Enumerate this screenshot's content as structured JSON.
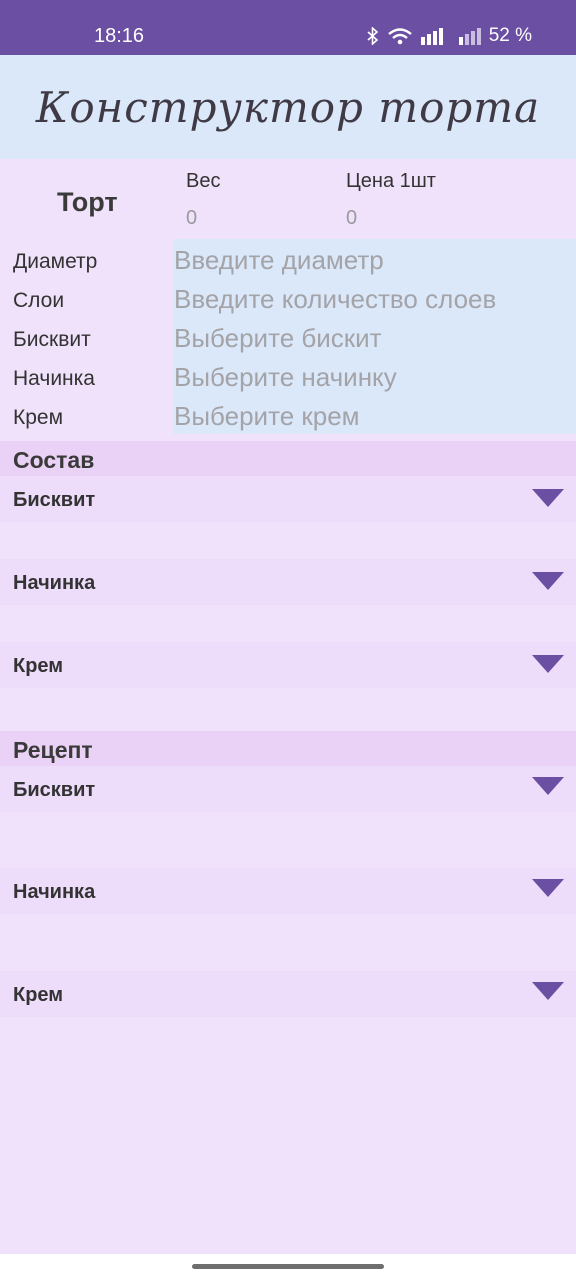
{
  "status_bar": {
    "time": "18:16",
    "battery": "52 %"
  },
  "title": "Конструктор торта",
  "cake": {
    "label": "Торт",
    "weight_label": "Вес",
    "weight_value": "0",
    "price_label": "Цена 1шт",
    "price_value": "0"
  },
  "fields": [
    {
      "label": "Диаметр",
      "placeholder": "Введите диаметр"
    },
    {
      "label": "Слои",
      "placeholder": "Введите количество слоев"
    },
    {
      "label": "Бисквит",
      "placeholder": "Выберите бискит"
    },
    {
      "label": "Начинка",
      "placeholder": "Выберите начинку"
    },
    {
      "label": "Крем",
      "placeholder": "Выберите крем"
    }
  ],
  "composition": {
    "title": "Состав",
    "items": [
      {
        "label": "Бисквит"
      },
      {
        "label": "Начинка"
      },
      {
        "label": "Крем"
      }
    ]
  },
  "recipe": {
    "title": "Рецепт",
    "items": [
      {
        "label": "Бисквит"
      },
      {
        "label": "Начинка"
      },
      {
        "label": "Крем"
      }
    ]
  },
  "colors": {
    "status_bar": "#6b4fa3",
    "header_bg": "#dbe8fa",
    "page_bg": "#f0e2fb",
    "section_bg": "#e9d2f6",
    "accent": "#6b4fa3"
  }
}
